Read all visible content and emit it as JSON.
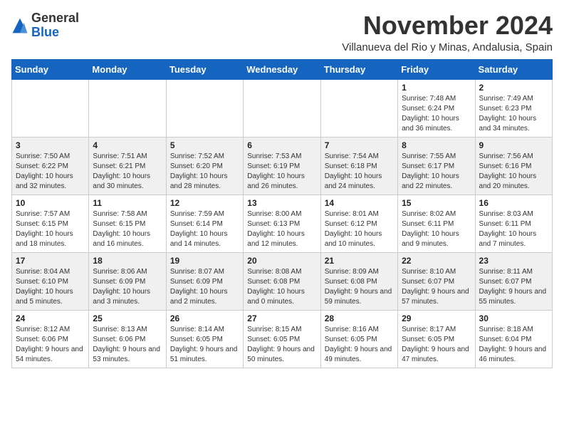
{
  "header": {
    "logo_general": "General",
    "logo_blue": "Blue",
    "month_year": "November 2024",
    "location": "Villanueva del Rio y Minas, Andalusia, Spain"
  },
  "days_of_week": [
    "Sunday",
    "Monday",
    "Tuesday",
    "Wednesday",
    "Thursday",
    "Friday",
    "Saturday"
  ],
  "weeks": [
    [
      {
        "day": "",
        "info": ""
      },
      {
        "day": "",
        "info": ""
      },
      {
        "day": "",
        "info": ""
      },
      {
        "day": "",
        "info": ""
      },
      {
        "day": "",
        "info": ""
      },
      {
        "day": "1",
        "info": "Sunrise: 7:48 AM\nSunset: 6:24 PM\nDaylight: 10 hours and 36 minutes."
      },
      {
        "day": "2",
        "info": "Sunrise: 7:49 AM\nSunset: 6:23 PM\nDaylight: 10 hours and 34 minutes."
      }
    ],
    [
      {
        "day": "3",
        "info": "Sunrise: 7:50 AM\nSunset: 6:22 PM\nDaylight: 10 hours and 32 minutes."
      },
      {
        "day": "4",
        "info": "Sunrise: 7:51 AM\nSunset: 6:21 PM\nDaylight: 10 hours and 30 minutes."
      },
      {
        "day": "5",
        "info": "Sunrise: 7:52 AM\nSunset: 6:20 PM\nDaylight: 10 hours and 28 minutes."
      },
      {
        "day": "6",
        "info": "Sunrise: 7:53 AM\nSunset: 6:19 PM\nDaylight: 10 hours and 26 minutes."
      },
      {
        "day": "7",
        "info": "Sunrise: 7:54 AM\nSunset: 6:18 PM\nDaylight: 10 hours and 24 minutes."
      },
      {
        "day": "8",
        "info": "Sunrise: 7:55 AM\nSunset: 6:17 PM\nDaylight: 10 hours and 22 minutes."
      },
      {
        "day": "9",
        "info": "Sunrise: 7:56 AM\nSunset: 6:16 PM\nDaylight: 10 hours and 20 minutes."
      }
    ],
    [
      {
        "day": "10",
        "info": "Sunrise: 7:57 AM\nSunset: 6:15 PM\nDaylight: 10 hours and 18 minutes."
      },
      {
        "day": "11",
        "info": "Sunrise: 7:58 AM\nSunset: 6:15 PM\nDaylight: 10 hours and 16 minutes."
      },
      {
        "day": "12",
        "info": "Sunrise: 7:59 AM\nSunset: 6:14 PM\nDaylight: 10 hours and 14 minutes."
      },
      {
        "day": "13",
        "info": "Sunrise: 8:00 AM\nSunset: 6:13 PM\nDaylight: 10 hours and 12 minutes."
      },
      {
        "day": "14",
        "info": "Sunrise: 8:01 AM\nSunset: 6:12 PM\nDaylight: 10 hours and 10 minutes."
      },
      {
        "day": "15",
        "info": "Sunrise: 8:02 AM\nSunset: 6:11 PM\nDaylight: 10 hours and 9 minutes."
      },
      {
        "day": "16",
        "info": "Sunrise: 8:03 AM\nSunset: 6:11 PM\nDaylight: 10 hours and 7 minutes."
      }
    ],
    [
      {
        "day": "17",
        "info": "Sunrise: 8:04 AM\nSunset: 6:10 PM\nDaylight: 10 hours and 5 minutes."
      },
      {
        "day": "18",
        "info": "Sunrise: 8:06 AM\nSunset: 6:09 PM\nDaylight: 10 hours and 3 minutes."
      },
      {
        "day": "19",
        "info": "Sunrise: 8:07 AM\nSunset: 6:09 PM\nDaylight: 10 hours and 2 minutes."
      },
      {
        "day": "20",
        "info": "Sunrise: 8:08 AM\nSunset: 6:08 PM\nDaylight: 10 hours and 0 minutes."
      },
      {
        "day": "21",
        "info": "Sunrise: 8:09 AM\nSunset: 6:08 PM\nDaylight: 9 hours and 59 minutes."
      },
      {
        "day": "22",
        "info": "Sunrise: 8:10 AM\nSunset: 6:07 PM\nDaylight: 9 hours and 57 minutes."
      },
      {
        "day": "23",
        "info": "Sunrise: 8:11 AM\nSunset: 6:07 PM\nDaylight: 9 hours and 55 minutes."
      }
    ],
    [
      {
        "day": "24",
        "info": "Sunrise: 8:12 AM\nSunset: 6:06 PM\nDaylight: 9 hours and 54 minutes."
      },
      {
        "day": "25",
        "info": "Sunrise: 8:13 AM\nSunset: 6:06 PM\nDaylight: 9 hours and 53 minutes."
      },
      {
        "day": "26",
        "info": "Sunrise: 8:14 AM\nSunset: 6:05 PM\nDaylight: 9 hours and 51 minutes."
      },
      {
        "day": "27",
        "info": "Sunrise: 8:15 AM\nSunset: 6:05 PM\nDaylight: 9 hours and 50 minutes."
      },
      {
        "day": "28",
        "info": "Sunrise: 8:16 AM\nSunset: 6:05 PM\nDaylight: 9 hours and 49 minutes."
      },
      {
        "day": "29",
        "info": "Sunrise: 8:17 AM\nSunset: 6:05 PM\nDaylight: 9 hours and 47 minutes."
      },
      {
        "day": "30",
        "info": "Sunrise: 8:18 AM\nSunset: 6:04 PM\nDaylight: 9 hours and 46 minutes."
      }
    ]
  ]
}
